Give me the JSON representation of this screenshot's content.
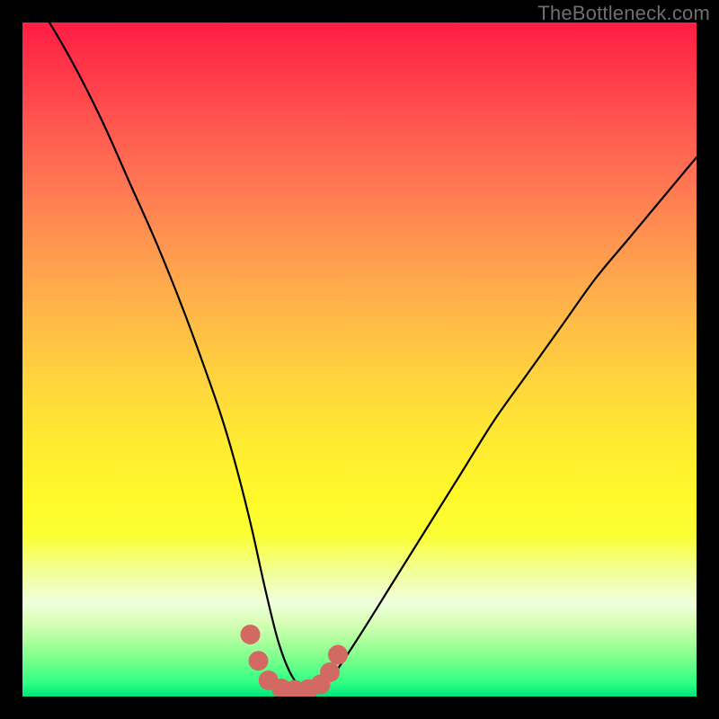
{
  "watermark": "TheBottleneck.com",
  "chart_data": {
    "type": "line",
    "title": "",
    "xlabel": "",
    "ylabel": "",
    "xlim": [
      0,
      100
    ],
    "ylim": [
      0,
      100
    ],
    "series": [
      {
        "name": "bottleneck-curve",
        "x": [
          0,
          4,
          8,
          12,
          16,
          20,
          24,
          28,
          30,
          32,
          34,
          36,
          38,
          40,
          42,
          44,
          46,
          50,
          55,
          60,
          65,
          70,
          75,
          80,
          85,
          90,
          95,
          100
        ],
        "values": [
          106,
          100,
          93,
          85,
          76,
          67,
          57,
          46,
          40,
          33,
          25,
          16,
          8,
          3,
          1,
          1,
          3,
          9,
          17,
          25,
          33,
          41,
          48,
          55,
          62,
          68,
          74,
          80
        ]
      }
    ],
    "markers": {
      "name": "trough-dots",
      "color": "#d26a63",
      "radius_px": 11,
      "points": [
        {
          "x": 33.8,
          "y": 9.2
        },
        {
          "x": 35.0,
          "y": 5.3
        },
        {
          "x": 36.5,
          "y": 2.4
        },
        {
          "x": 38.4,
          "y": 1.2
        },
        {
          "x": 40.4,
          "y": 1.0
        },
        {
          "x": 42.4,
          "y": 1.1
        },
        {
          "x": 44.2,
          "y": 1.8
        },
        {
          "x": 45.6,
          "y": 3.6
        },
        {
          "x": 46.8,
          "y": 6.2
        }
      ]
    },
    "background": "rainbow-vertical-gradient"
  }
}
